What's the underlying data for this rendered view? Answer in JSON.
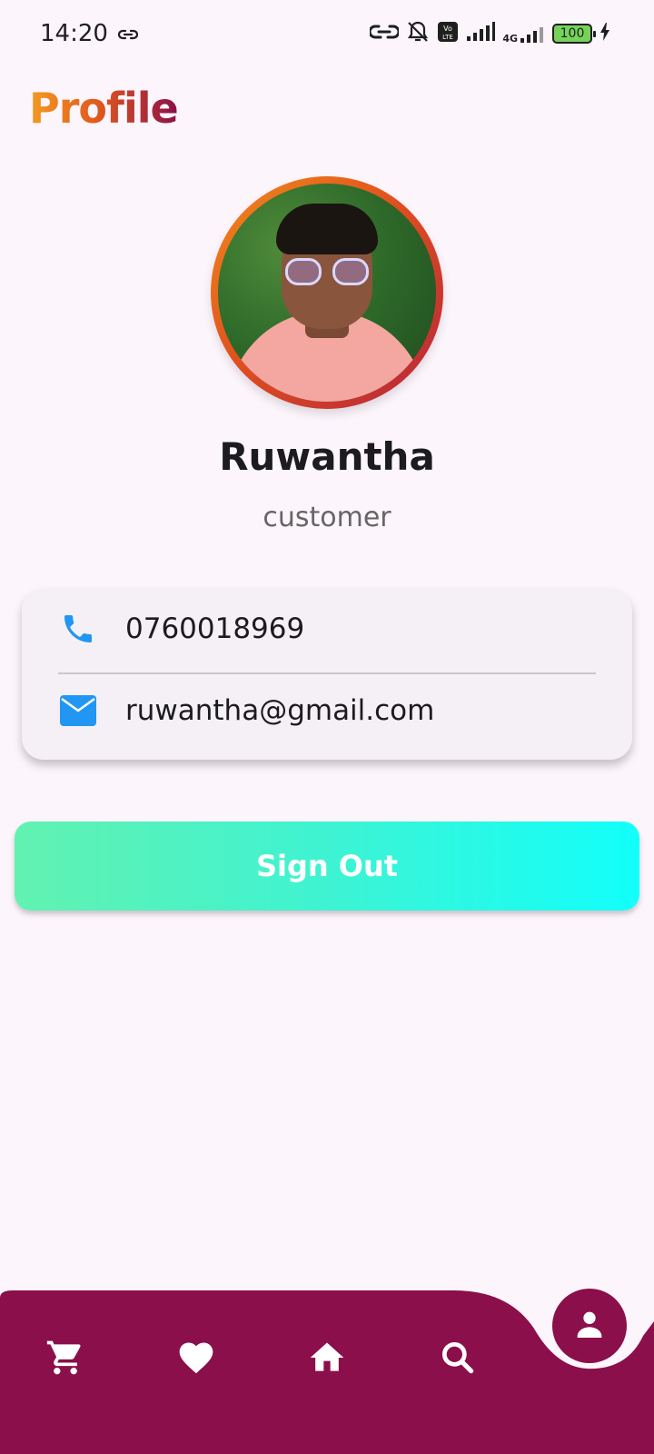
{
  "status_bar": {
    "time": "14:20",
    "network_label": "4G",
    "volte_label": "Vo LTE",
    "battery": "100"
  },
  "header": {
    "title": "Profile"
  },
  "profile": {
    "name": "Ruwantha",
    "role": "customer"
  },
  "contact": {
    "phone": "0760018969",
    "email": "ruwantha@gmail.com",
    "phone_icon": "phone-icon",
    "email_icon": "email-icon"
  },
  "actions": {
    "sign_out_label": "Sign Out"
  },
  "bottom_nav": {
    "items": [
      {
        "icon": "cart-icon"
      },
      {
        "icon": "heart-icon"
      },
      {
        "icon": "home-icon"
      },
      {
        "icon": "search-icon"
      },
      {
        "icon": "person-icon",
        "active": true
      }
    ]
  },
  "colors": {
    "accent": "#8a0f4a",
    "title_gradient_start": "#f39a22",
    "title_gradient_end": "#8b1048",
    "signout_gradient_start": "#62f2b0",
    "signout_gradient_end": "#12fffb",
    "contact_icon": "#2196f3"
  }
}
